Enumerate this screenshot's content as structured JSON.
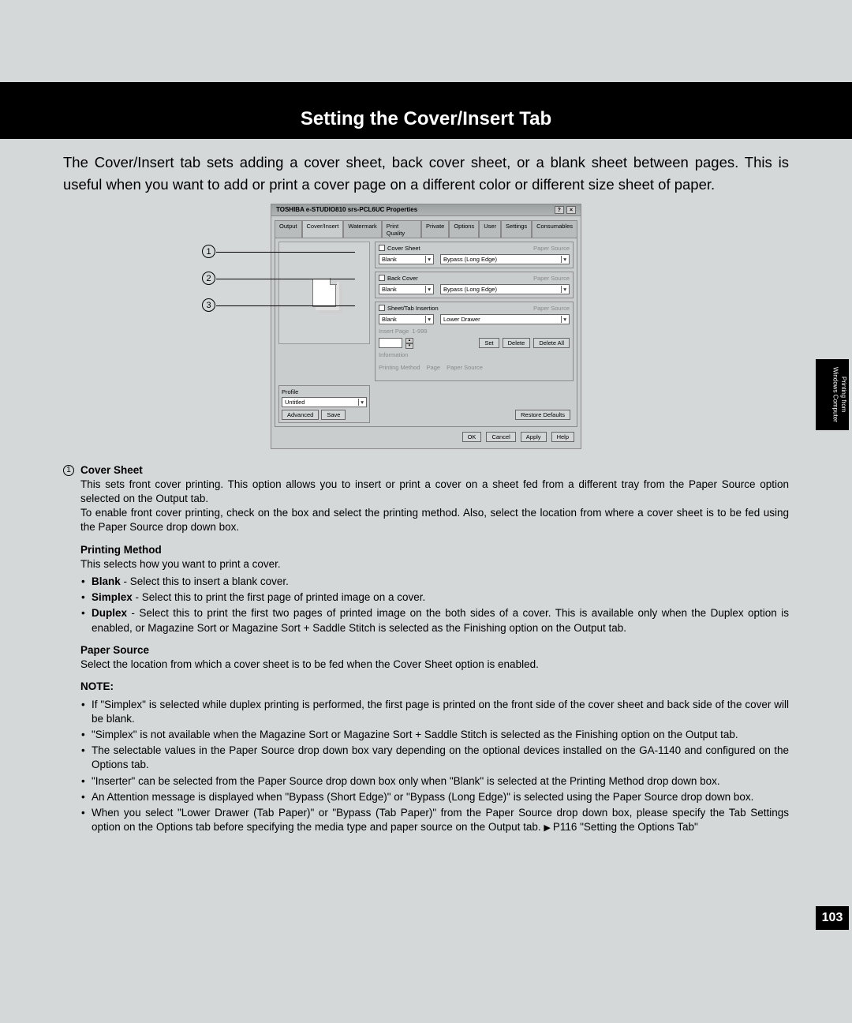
{
  "header": {
    "title": "Setting the Cover/Insert Tab"
  },
  "intro": "The Cover/Insert tab sets adding a cover sheet, back cover sheet, or a blank sheet between pages. This is useful when you want to add or print a cover page on a different color or different size sheet of paper.",
  "dialog": {
    "title": "TOSHIBA e-STUDIO810 srs-PCL6UC Properties",
    "tabs": [
      "Output",
      "Cover/Insert",
      "Watermark",
      "Print Quality",
      "Private",
      "Options",
      "User",
      "Settings",
      "Consumables"
    ],
    "active_tab": "Cover/Insert",
    "cover_sheet": {
      "label": "Cover Sheet",
      "method": "Blank",
      "source_label": "Paper Source",
      "source": "Bypass (Long Edge)"
    },
    "back_cover": {
      "label": "Back Cover",
      "method": "Blank",
      "source_label": "Paper Source",
      "source": "Bypass (Long Edge)"
    },
    "sheet_tab": {
      "label": "Sheet/Tab Insertion",
      "method": "Blank",
      "source_label": "Paper Source",
      "source": "Lower Drawer",
      "insert_page_label": "Insert Page",
      "insert_page_hint": "1-999",
      "buttons": {
        "set": "Set",
        "delete": "Delete",
        "delete_all": "Delete All"
      },
      "info_label": "Information",
      "info_cols": {
        "a": "Printing Method",
        "b": "Page",
        "c": "Paper Source"
      }
    },
    "profile": {
      "label": "Profile",
      "value": "Untitled",
      "advanced": "Advanced",
      "save": "Save"
    },
    "restore": "Restore Defaults",
    "footer": {
      "ok": "OK",
      "cancel": "Cancel",
      "apply": "Apply",
      "help": "Help"
    }
  },
  "callouts": [
    "1",
    "2",
    "3"
  ],
  "desc": {
    "item1_title": "Cover Sheet",
    "item1_body": "This sets front cover printing.  This option allows you to insert or print a cover on a sheet fed from a different tray from the Paper Source option selected on the Output tab.\nTo enable front cover printing, check on the box and select the printing method.  Also, select the location from where a cover sheet is to be fed using the Paper Source drop down box.",
    "pm_title": "Printing Method",
    "pm_intro": "This selects how you want to print a cover.",
    "pm_items": [
      {
        "b": "Blank",
        "t": " - Select this to insert a blank cover."
      },
      {
        "b": "Simplex",
        "t": " - Select this to print the first page of printed image on a cover."
      },
      {
        "b": "Duplex",
        "t": " - Select this to print the first two pages of printed image on the both sides of a cover.  This is available only when the Duplex option is enabled, or Magazine Sort or Magazine Sort + Saddle Stitch is selected as the Finishing option on the Output tab."
      }
    ],
    "ps_title": "Paper Source",
    "ps_body": "Select the location from which a cover sheet is to be fed when the Cover Sheet option is enabled.",
    "note_title": "NOTE:",
    "notes": [
      "If \"Simplex\" is selected while duplex printing is performed, the first page is printed on the front side of the cover sheet and back side of the cover will be blank.",
      "\"Simplex\" is not available when the Magazine Sort or Magazine Sort + Saddle Stitch is selected as the Finishing option on the Output tab.",
      "The selectable values in the Paper Source drop down box vary depending on the optional devices installed on the GA-1140 and configured on the Options tab.",
      "\"Inserter\" can be selected from the Paper Source drop down box only when \"Blank\" is selected at the Printing Method drop down box.",
      "An Attention message is displayed when \"Bypass (Short Edge)\" or \"Bypass (Long Edge)\" is selected using the Paper Source drop down box.",
      "When you select \"Lower Drawer (Tab Paper)\" or \"Bypass (Tab Paper)\" from the Paper Source drop down box, please specify the Tab Settings option on the Options tab before specifying the media type and paper source on the Output tab."
    ],
    "note_ref": "P116 \"Setting the Options Tab\""
  },
  "sidetab": {
    "line1": "Printing from",
    "line2": "Windows Computer"
  },
  "page_number": "103"
}
